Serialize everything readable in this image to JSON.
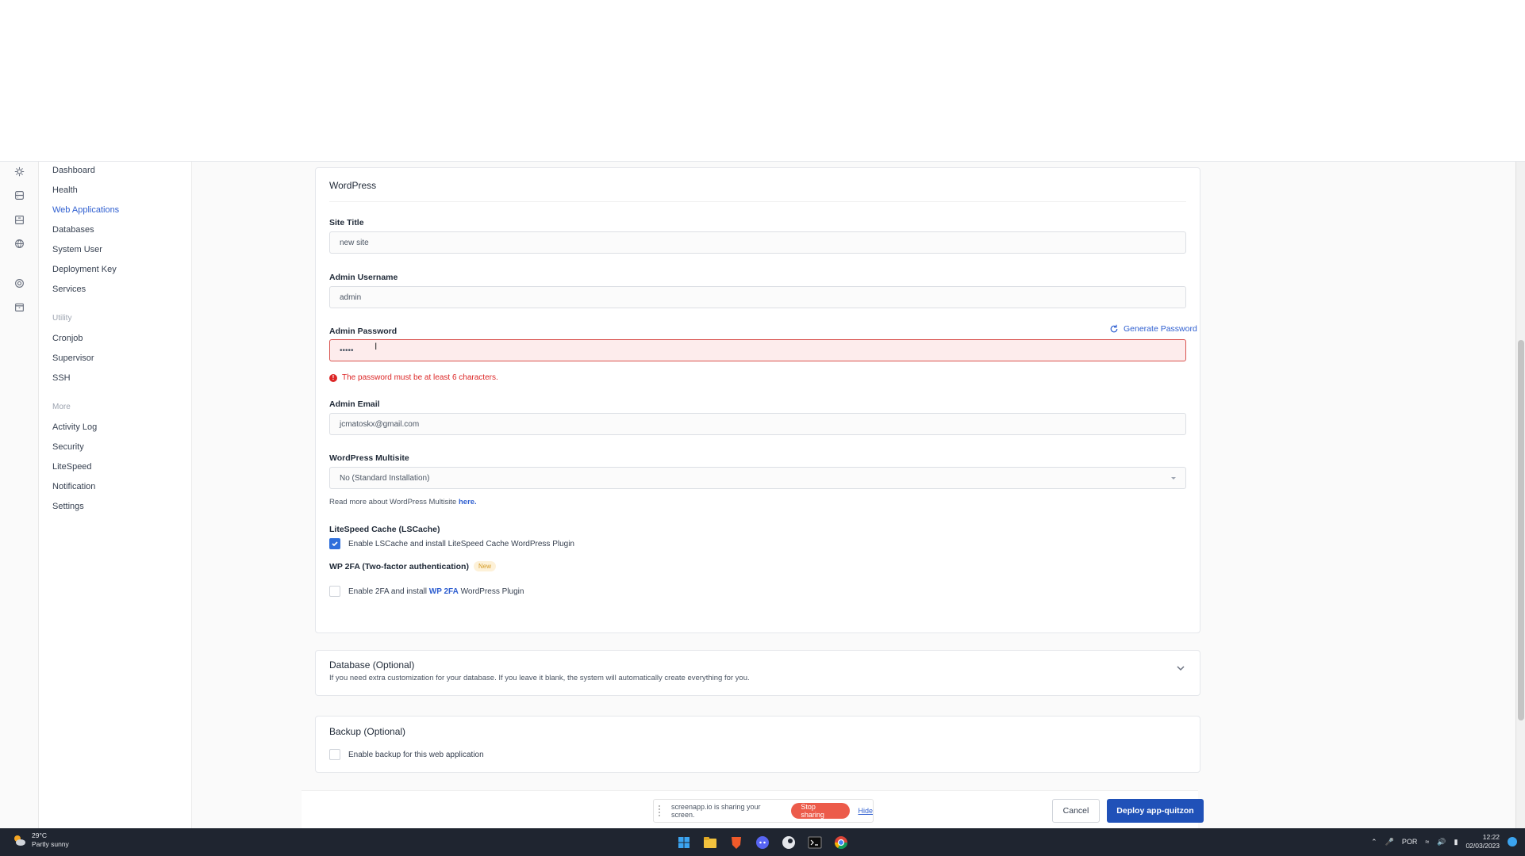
{
  "sidebar": {
    "items": [
      {
        "label": "Dashboard"
      },
      {
        "label": "Health"
      },
      {
        "label": "Web Applications",
        "active": true
      },
      {
        "label": "Databases"
      },
      {
        "label": "System User"
      },
      {
        "label": "Deployment Key"
      },
      {
        "label": "Services"
      }
    ],
    "utility_heading": "Utility",
    "utility_items": [
      {
        "label": "Cronjob"
      },
      {
        "label": "Supervisor"
      },
      {
        "label": "SSH"
      }
    ],
    "more_heading": "More",
    "more_items": [
      {
        "label": "Activity Log"
      },
      {
        "label": "Security"
      },
      {
        "label": "LiteSpeed"
      },
      {
        "label": "Notification"
      },
      {
        "label": "Settings"
      }
    ]
  },
  "wordpress": {
    "title": "WordPress",
    "site_title_label": "Site Title",
    "site_title_value": "new site",
    "admin_username_label": "Admin Username",
    "admin_username_value": "admin",
    "admin_password_label": "Admin Password",
    "generate_password": "Generate Password",
    "admin_password_value": "•••••",
    "password_error": "The password must be at least 6 characters.",
    "admin_email_label": "Admin Email",
    "admin_email_value": "jcmatoskx@gmail.com",
    "multisite_label": "WordPress Multisite",
    "multisite_value": "No (Standard Installation)",
    "multisite_note": "Read more about WordPress Multisite ",
    "multisite_link": "here.",
    "lscache_label": "LiteSpeed Cache (LSCache)",
    "lscache_checkbox": "Enable LSCache and install LiteSpeed Cache WordPress Plugin",
    "lscache_checked": true,
    "wp2fa_label": "WP 2FA (Two-factor authentication)",
    "wp2fa_badge": "New",
    "wp2fa_checkbox_pre": "Enable 2FA and install ",
    "wp2fa_checkbox_link": "WP 2FA",
    "wp2fa_checkbox_post": " WordPress Plugin",
    "wp2fa_checked": false
  },
  "database": {
    "title": "Database (Optional)",
    "note": "If you need extra customization for your database. If you leave it blank, the system will automatically create everything for you."
  },
  "backup": {
    "title": "Backup (Optional)",
    "checkbox": "Enable backup for this web application",
    "checked": false
  },
  "footer": {
    "share_text": "screenapp.io is sharing your screen.",
    "stop_sharing": "Stop sharing",
    "hide": "Hide",
    "cancel": "Cancel",
    "deploy": "Deploy app-quitzon"
  },
  "taskbar": {
    "temperature": "29°C",
    "weather": "Partly sunny",
    "language": "POR",
    "time": "12:22",
    "date": "02/03/2023"
  },
  "colors": {
    "accent": "#2f5fd0",
    "deploy": "#2051b8",
    "error": "#dc2626",
    "stop": "#ec5b4a"
  }
}
